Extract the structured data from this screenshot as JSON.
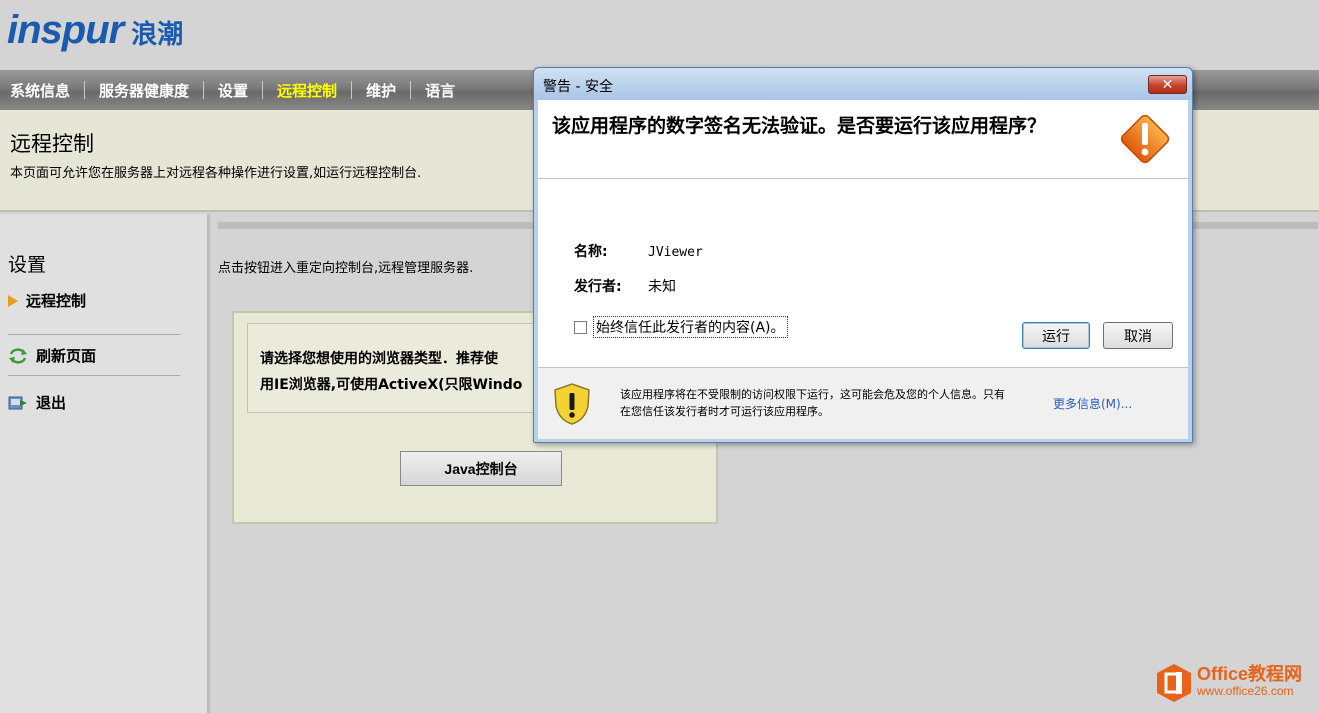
{
  "brand": {
    "logo_text": "inspur",
    "logo_cn": "浪潮"
  },
  "topnav": {
    "items": [
      {
        "label": "系统信息",
        "active": false
      },
      {
        "label": "服务器健康度",
        "active": false
      },
      {
        "label": "设置",
        "active": false
      },
      {
        "label": "远程控制",
        "active": true
      },
      {
        "label": "维护",
        "active": false
      },
      {
        "label": "语言",
        "active": false
      }
    ]
  },
  "page": {
    "title": "远程控制",
    "description": "本页面可允许您在服务器上对远程各种操作进行设置,如运行远程控制台."
  },
  "sidebar": {
    "section_title": "设置",
    "items": [
      {
        "label": "远程控制",
        "icon": "arrow-right-icon"
      },
      {
        "label": "刷新页面",
        "icon": "refresh-icon"
      },
      {
        "label": "退出",
        "icon": "logout-icon"
      }
    ]
  },
  "content": {
    "hint": "点击按钮进入重定向控制台,远程管理服务器.",
    "panel": {
      "line1": "请选择您想使用的浏览器类型．推荐使",
      "line2": "用IE浏览器,可使用ActiveX(只限Windo",
      "java_button": "Java控制台"
    }
  },
  "dialog": {
    "title": "警告 - 安全",
    "close_label": "✕",
    "headline": "该应用程序的数字签名无法验证。是否要运行该应用程序？",
    "name_label": "名称:",
    "name_value": "JViewer",
    "publisher_label": "发行者:",
    "publisher_value": "未知",
    "checkbox_label": "始终信任此发行者的内容(A)。",
    "checkbox_checked": false,
    "run_button": "运行",
    "cancel_button": "取消",
    "footer_message": "该应用程序将在不受限制的访问权限下运行，这可能会危及您的个人信息。只有在您信任该发行者时才可运行该应用程序。",
    "more_info": "更多信息(M)..."
  },
  "watermark": {
    "line1": "Office教程网",
    "line2": "www.office26.com"
  },
  "colors": {
    "accent_orange": "#e8621a",
    "nav_active": "#ffff00",
    "logo_blue": "#1a5bb0"
  }
}
